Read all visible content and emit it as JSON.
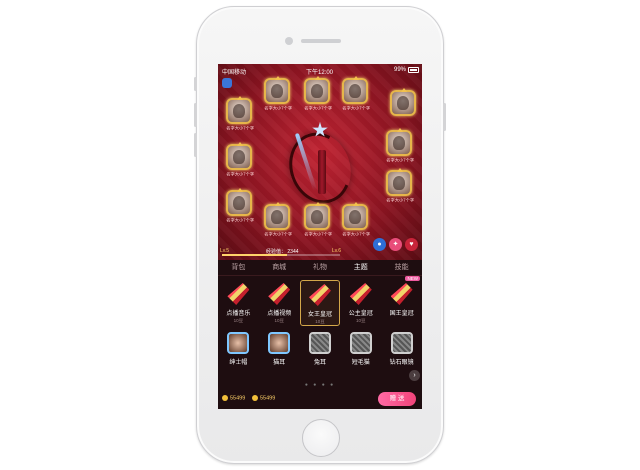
{
  "status_bar": {
    "carrier": "中国移动",
    "time": "下午12:00",
    "battery": "99%"
  },
  "room": {
    "seat_name": "名字大小7个字",
    "level_left": "Lv.5",
    "level_right": "Lv.6",
    "exp_label": "经验值：",
    "exp_value": "2344",
    "progress": 0.55
  },
  "panel": {
    "tabs": [
      {
        "label": "背包",
        "active": false
      },
      {
        "label": "商城",
        "active": false
      },
      {
        "label": "礼物",
        "active": false
      },
      {
        "label": "主题",
        "active": true
      },
      {
        "label": "技能",
        "active": false
      }
    ],
    "row1": [
      {
        "label": "点播音乐",
        "price": "10豆"
      },
      {
        "label": "点播视频",
        "price": "10豆"
      },
      {
        "label": "女王皇冠",
        "price": "10豆",
        "selected": true
      },
      {
        "label": "公主皇冠",
        "price": "10豆"
      },
      {
        "label": "国王皇冠",
        "price": "",
        "badge": "NEW"
      }
    ],
    "row2": [
      {
        "label": "绅士帽"
      },
      {
        "label": "猫耳"
      },
      {
        "label": "兔耳"
      },
      {
        "label": "短毛猫"
      },
      {
        "label": "钻石眼镜"
      }
    ],
    "coins": [
      "55499",
      "55499"
    ],
    "give_label": "赠 送"
  },
  "colors": {
    "accent": "#f2447a",
    "gold": "#e6b64a",
    "room_red": "#c12433"
  }
}
